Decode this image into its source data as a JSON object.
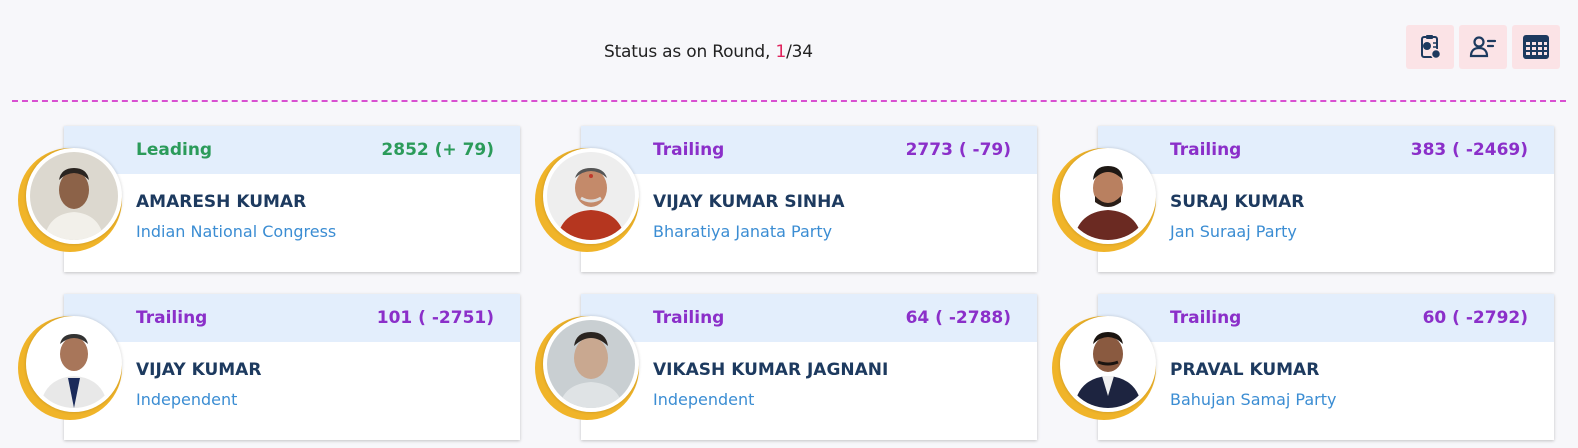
{
  "header": {
    "status_prefix": "Status as on Round, ",
    "current_round": "1",
    "round_sep": "/",
    "total_rounds": "34"
  },
  "toolbar": {
    "icons": [
      "report-icon",
      "candidate-list-icon",
      "grid-view-icon"
    ]
  },
  "colors": {
    "leading": "#2b9b5a",
    "trailing": "#8b2fc9",
    "header_bg": "#e3eefc",
    "ring": "#f0b429",
    "divider": "#d94fd1"
  },
  "candidates": [
    {
      "status": "Leading",
      "votes": "2852 (+ 79)",
      "name": "AMARESH KUMAR",
      "party": "Indian National Congress"
    },
    {
      "status": "Trailing",
      "votes": "2773 ( -79)",
      "name": "VIJAY KUMAR SINHA",
      "party": "Bharatiya Janata Party"
    },
    {
      "status": "Trailing",
      "votes": "383 ( -2469)",
      "name": "SURAJ KUMAR",
      "party": "Jan Suraaj Party"
    },
    {
      "status": "Trailing",
      "votes": "101 ( -2751)",
      "name": "VIJAY KUMAR",
      "party": "Independent"
    },
    {
      "status": "Trailing",
      "votes": "64 ( -2788)",
      "name": "VIKASH KUMAR JAGNANI",
      "party": "Independent"
    },
    {
      "status": "Trailing",
      "votes": "60 ( -2792)",
      "name": "PRAVAL KUMAR",
      "party": "Bahujan Samaj Party"
    }
  ]
}
